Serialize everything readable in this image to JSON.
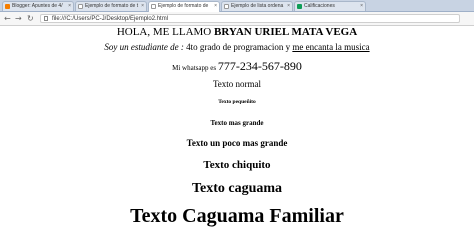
{
  "tabs": [
    {
      "label": "Blogger: Apuntes de 4/"
    },
    {
      "label": "Ejemplo de formato de t"
    },
    {
      "label": "Ejemplo de formato de"
    },
    {
      "label": "Ejemplo de lista ordena"
    },
    {
      "label": "Calificaciones"
    }
  ],
  "address": {
    "url": "file:///C:/Users/PC-J/Desktop/Ejemplo2.html"
  },
  "page": {
    "greeting_prefix": "HOLA, ME LLAMO ",
    "greeting_name": "BRYAN URIEL MATA VEGA",
    "student_italic": "Soy un estudiante de :",
    "student_mid": " 4to grado de programacion y ",
    "student_underlined": "me encanta la musica",
    "whatsapp_label": "Mi whatsapp es ",
    "whatsapp_number": "777-234-567-890",
    "texto_normal": "Texto normal",
    "texto_pequenito": "Texto pequeñito",
    "texto_mas_grande": "Texto mas grande",
    "texto_poco_mas_grande": "Texto un poco mas grande",
    "texto_chiquito": "Texto chiquito",
    "texto_caguama": "Texto caguama",
    "texto_caguama_familiar": "Texto Caguama Familiar"
  }
}
